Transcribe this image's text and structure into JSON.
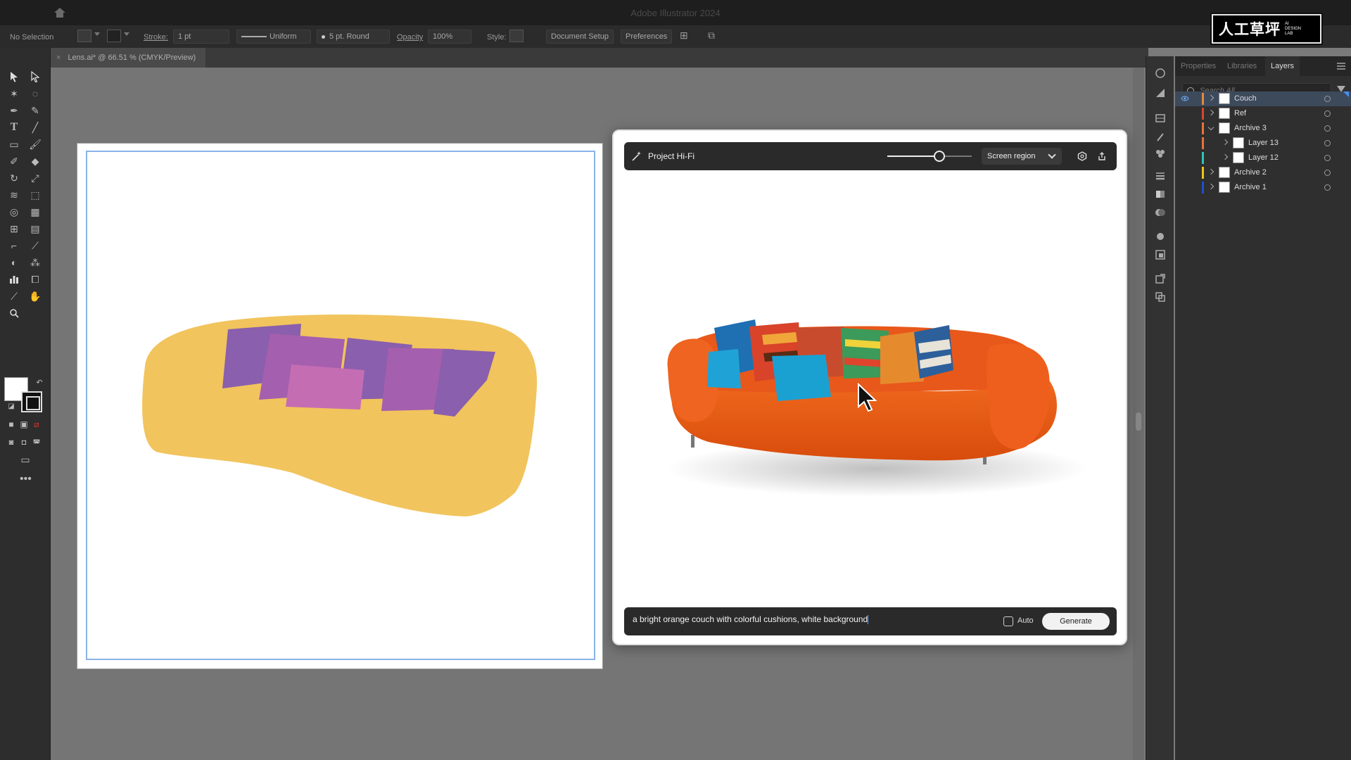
{
  "app": {
    "title": "Adobe Illustrator 2024",
    "brand_cn": "人工草坪",
    "brand_en": "AI DESIGN LAB"
  },
  "control_bar": {
    "selection": "No Selection",
    "stroke_label": "Stroke:",
    "stroke_value": "1 pt",
    "profile": "Uniform",
    "brush": "5 pt. Round",
    "opacity_label": "Opacity",
    "opacity_value": "100%",
    "style_label": "Style:",
    "document_setup": "Document Setup",
    "preferences": "Preferences"
  },
  "document": {
    "tab_title": "Lens.ai* @ 66.51 % (CMYK/Preview)",
    "close_glyph": "×"
  },
  "sketch_colors": {
    "couch": "#f1c45d",
    "pillow_dark": "#8a5fad",
    "pillow_mid": "#a45fae",
    "pillow_light": "#c56db3"
  },
  "hifi": {
    "title": "Project Hi-Fi",
    "slider_value": 0.62,
    "region": "Screen region",
    "prompt": "a bright orange couch with colorful cushions, white background",
    "auto_label": "Auto",
    "auto_checked": false,
    "generate": "Generate"
  },
  "panels": {
    "tabs": [
      "Properties",
      "Libraries",
      "Layers"
    ],
    "active_tab": "Layers",
    "search_placeholder": "Search All",
    "layers": [
      {
        "name": "Couch",
        "color": "#e58a3a",
        "indent": 0,
        "expanded": false,
        "visible": true,
        "selected": true
      },
      {
        "name": "Ref",
        "color": "#d9472b",
        "indent": 0,
        "expanded": false,
        "visible": false,
        "selected": false
      },
      {
        "name": "Archive 3",
        "color": "#e8733a",
        "indent": 0,
        "expanded": true,
        "visible": false,
        "selected": false
      },
      {
        "name": "Layer 13",
        "color": "#e8733a",
        "indent": 1,
        "expanded": false,
        "visible": false,
        "selected": false
      },
      {
        "name": "Layer 12",
        "color": "#2ec4b6",
        "indent": 1,
        "expanded": false,
        "visible": false,
        "selected": false
      },
      {
        "name": "Archive 2",
        "color": "#f0c419",
        "indent": 0,
        "expanded": false,
        "visible": false,
        "selected": false
      },
      {
        "name": "Archive 1",
        "color": "#1f4fd1",
        "indent": 0,
        "expanded": false,
        "visible": false,
        "selected": false
      }
    ]
  }
}
